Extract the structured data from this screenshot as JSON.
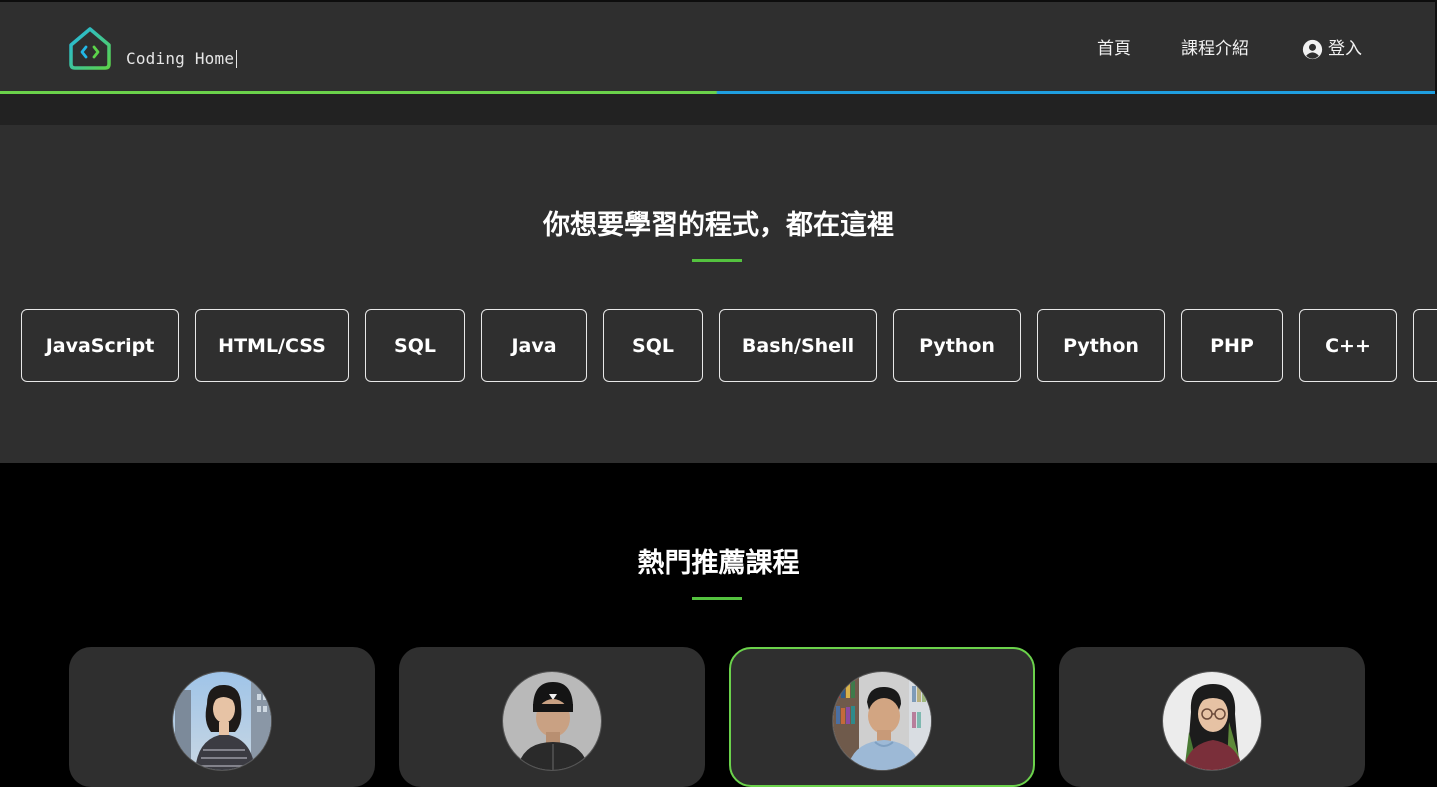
{
  "header": {
    "brand": "Coding Home",
    "nav": {
      "home": "首頁",
      "courses": "課程介紹",
      "login": "登入"
    },
    "progress_colors": {
      "left": "#6bd24b",
      "right": "#1f9fe0"
    }
  },
  "languages_section": {
    "title": "你想要學習的程式，都在這裡",
    "chips": [
      "JavaScript",
      "HTML/CSS",
      "SQL",
      "Java",
      "SQL",
      "Bash/Shell",
      "Python",
      "Python",
      "PHP",
      "C++",
      ""
    ]
  },
  "courses_section": {
    "title": "熱門推薦課程",
    "cards": [
      {
        "avatar_icon": "instructor-photo-woman-city",
        "active": false
      },
      {
        "avatar_icon": "instructor-photo-man-beanie",
        "active": false
      },
      {
        "avatar_icon": "instructor-photo-man-library",
        "active": true
      },
      {
        "avatar_icon": "instructor-photo-woman-glasses",
        "active": false
      }
    ]
  },
  "colors": {
    "accent_green": "#54c23f",
    "header_bg": "#2f2f2f",
    "page_bg": "#000000"
  }
}
